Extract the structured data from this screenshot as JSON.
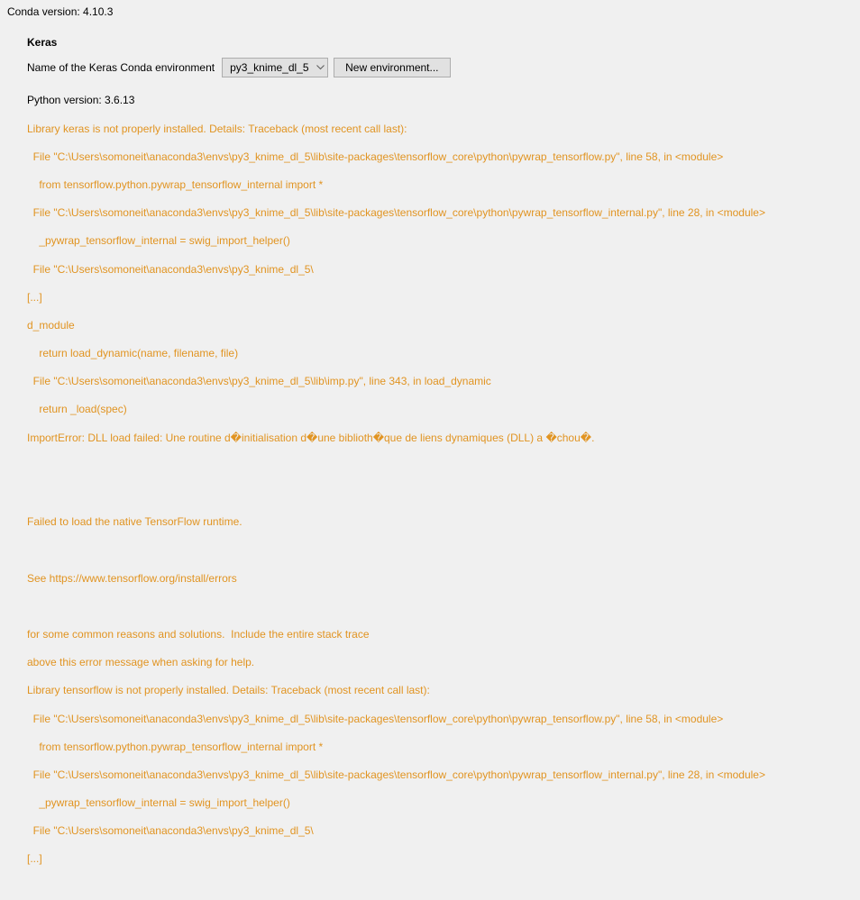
{
  "conda_version": "Conda version: 4.10.3",
  "section_title": "Keras",
  "env_label": "Name of the Keras Conda environment",
  "env_selected": "py3_knime_dl_5",
  "new_env_button": "New environment...",
  "python_version": "Python version: 3.6.13",
  "error_lines": {
    "l0": "Library keras is not properly installed. Details: Traceback (most recent call last):",
    "l1": "  File \"C:\\Users\\somoneit\\anaconda3\\envs\\py3_knime_dl_5\\lib\\site-packages\\tensorflow_core\\python\\pywrap_tensorflow.py\", line 58, in <module>",
    "l2": "    from tensorflow.python.pywrap_tensorflow_internal import *",
    "l3": "  File \"C:\\Users\\somoneit\\anaconda3\\envs\\py3_knime_dl_5\\lib\\site-packages\\tensorflow_core\\python\\pywrap_tensorflow_internal.py\", line 28, in <module>",
    "l4": "    _pywrap_tensorflow_internal = swig_import_helper()",
    "l5": "  File \"C:\\Users\\somoneit\\anaconda3\\envs\\py3_knime_dl_5\\",
    "l6": "[...]",
    "l7": "d_module",
    "l8": "    return load_dynamic(name, filename, file)",
    "l9": "  File \"C:\\Users\\somoneit\\anaconda3\\envs\\py3_knime_dl_5\\lib\\imp.py\", line 343, in load_dynamic",
    "l10": "    return _load(spec)",
    "l11": "ImportError: DLL load failed: Une routine d�initialisation d�une biblioth�que de liens dynamiques (DLL) a �chou�.",
    "l12": "",
    "l13": "",
    "l14": "Failed to load the native TensorFlow runtime.",
    "l15": "",
    "l16": "See https://www.tensorflow.org/install/errors",
    "l17": "",
    "l18": "for some common reasons and solutions.  Include the entire stack trace",
    "l19": "above this error message when asking for help.",
    "l20": "Library tensorflow is not properly installed. Details: Traceback (most recent call last):",
    "l21": "  File \"C:\\Users\\somoneit\\anaconda3\\envs\\py3_knime_dl_5\\lib\\site-packages\\tensorflow_core\\python\\pywrap_tensorflow.py\", line 58, in <module>",
    "l22": "    from tensorflow.python.pywrap_tensorflow_internal import *",
    "l23": "  File \"C:\\Users\\somoneit\\anaconda3\\envs\\py3_knime_dl_5\\lib\\site-packages\\tensorflow_core\\python\\pywrap_tensorflow_internal.py\", line 28, in <module>",
    "l24": "    _pywrap_tensorflow_internal = swig_import_helper()",
    "l25": "  File \"C:\\Users\\somoneit\\anaconda3\\envs\\py3_knime_dl_5\\",
    "l26": "[...]"
  }
}
